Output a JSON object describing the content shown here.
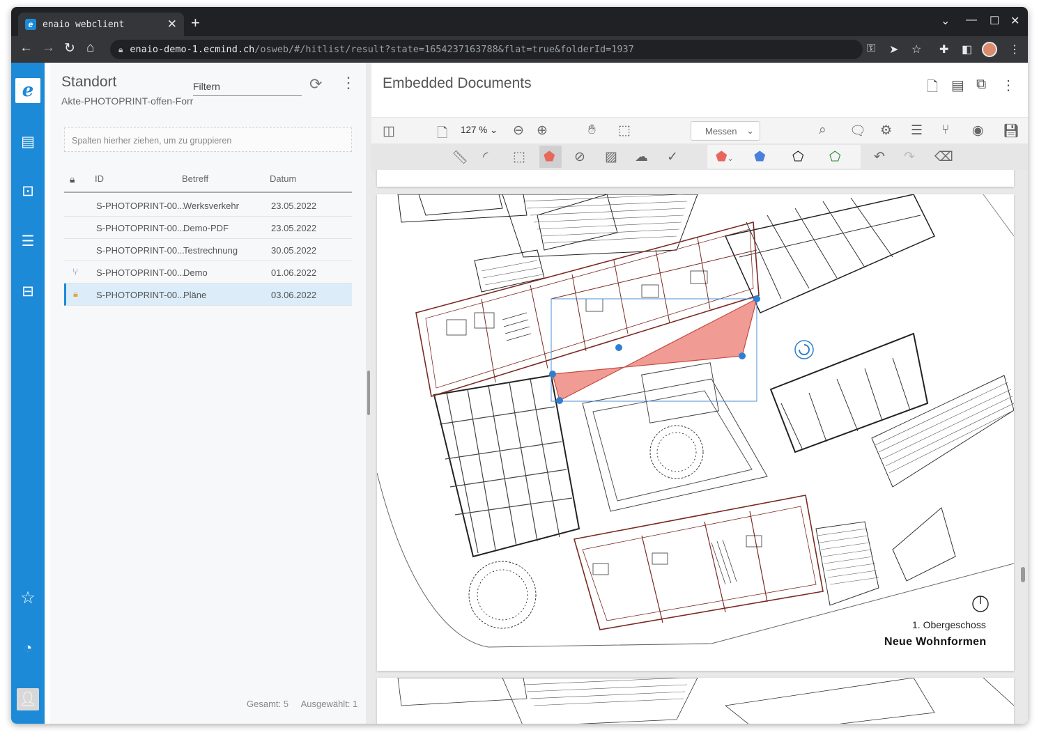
{
  "browser": {
    "tab_title": "enaio webclient",
    "tab_favicon": "e",
    "new_tab": "+",
    "url_host": "enaio-demo-1.ecmind.ch",
    "url_path": "/osweb/#/hitlist/result?state=1654237163788&flat=true&folderId=1937"
  },
  "rail": {
    "logo": "e",
    "items": [
      "documents-icon",
      "desktop-icon",
      "inbox-icon",
      "case-icon"
    ],
    "bottom": [
      "star-icon",
      "dashboard-icon",
      "user-icon"
    ]
  },
  "left_panel": {
    "title": "Standort",
    "subtitle": "Akte-PHOTOPRINT-offen-Forr",
    "filter_label": "Filtern",
    "group_hint": "Spalten hierher ziehen, um zu gruppieren",
    "columns": [
      "ID",
      "Betreff",
      "Datum"
    ],
    "rows": [
      {
        "icon": "",
        "id": "S-PHOTOPRINT-00...",
        "subject": "Werksverkehr",
        "date": "23.05.2022"
      },
      {
        "icon": "",
        "id": "S-PHOTOPRINT-00...",
        "subject": "Demo-PDF",
        "date": "23.05.2022"
      },
      {
        "icon": "",
        "id": "S-PHOTOPRINT-00...",
        "subject": "Testrechnung",
        "date": "30.05.2022"
      },
      {
        "icon": "hierarchy-icon",
        "id": "S-PHOTOPRINT-00...",
        "subject": "Demo",
        "date": "01.06.2022"
      },
      {
        "icon": "lock-icon",
        "id": "S-PHOTOPRINT-00...",
        "subject": "Pläne",
        "date": "03.06.2022"
      }
    ],
    "footer_total": "Gesamt: 5",
    "footer_selected": "Ausgewählt: 1"
  },
  "viewer": {
    "title": "Embedded Documents",
    "zoom": "127 %",
    "measure_select": "Messen",
    "annotation_color": "#e8665a",
    "plan_caption_small": "1. Obergeschoss",
    "plan_caption_large": "Neue Wohnformen"
  },
  "colors": {
    "brand": "#1d8ad8",
    "selection": "#dcecf8",
    "plan_lines": "#7a2a22"
  }
}
